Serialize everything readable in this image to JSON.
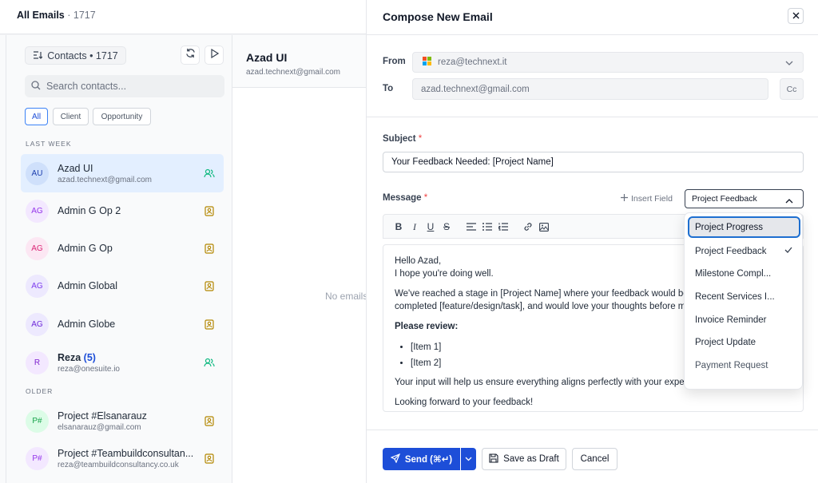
{
  "header": {
    "title": "All Emails",
    "count": "· 1717"
  },
  "contacts": {
    "pill_label": "Contacts • 1717",
    "search_placeholder": "Search contacts...",
    "filters": [
      "All",
      "Client",
      "Opportunity"
    ],
    "section_last_week": "LAST WEEK",
    "section_older": "OLDER",
    "items": [
      {
        "initials": "AU",
        "name": "Azad UI",
        "email": "azad.technext@gmail.com",
        "icon": "users-icon",
        "selected": true
      },
      {
        "initials": "AG",
        "name": "Admin G Op 2",
        "email": "",
        "icon": "contact-card-icon"
      },
      {
        "initials": "AG",
        "name": "Admin G Op",
        "email": "",
        "icon": "contact-card-icon"
      },
      {
        "initials": "AG",
        "name": "Admin Global",
        "email": "",
        "icon": "contact-card-icon"
      },
      {
        "initials": "AG",
        "name": "Admin Globe",
        "email": "",
        "icon": "contact-card-icon"
      },
      {
        "initials": "R",
        "name": "Reza",
        "count": "(5)",
        "email": "reza@onesuite.io",
        "icon": "users-icon"
      },
      {
        "initials": "P#",
        "name": "Project #Elsanarauz",
        "email": "elsanarauz@gmail.com",
        "icon": "contact-card-icon"
      },
      {
        "initials": "P#",
        "name": "Project #Teambuildconsultan...",
        "email": "reza@teambuildconsultancy.co.uk",
        "icon": "contact-card-icon"
      }
    ]
  },
  "thread": {
    "name": "Azad UI",
    "email": "azad.technext@gmail.com",
    "empty": "No emails"
  },
  "compose": {
    "title": "Compose New Email",
    "from_label": "From",
    "from_value": "reza@technext.it",
    "to_label": "To",
    "to_value": "azad.technext@gmail.com",
    "cc_label": "Cc",
    "subject_label": "Subject",
    "subject_value": "Your Feedback Needed: [Project Name]",
    "message_label": "Message",
    "insert_field": "Insert Field",
    "template_selected": "Project Feedback",
    "body": {
      "greeting": "Hello Azad,",
      "line1": "I hope you're doing well.",
      "para1a": "We've reached a stage in [Project Name] where your feedback would be",
      "para1b": "completed [feature/design/task], and would love your thoughts before m",
      "review": "Please review:",
      "items": [
        "[Item 1]",
        "[Item 2]"
      ],
      "para2": "Your input will help us ensure everything aligns perfectly with your expe",
      "closing": "Looking forward to your feedback!"
    },
    "send_label": "Send (⌘↵)",
    "draft_label": "Save as Draft",
    "cancel_label": "Cancel"
  },
  "templates_menu": [
    "Project Progress",
    "Project Feedback",
    "Milestone Compl...",
    "Recent Services I...",
    "Invoice Reminder",
    "Project Update",
    "Payment Request"
  ],
  "colors": {
    "accent": "#1d4ed8",
    "selected_row": "#e3efff",
    "highlight_border": "#1e6fd0"
  }
}
